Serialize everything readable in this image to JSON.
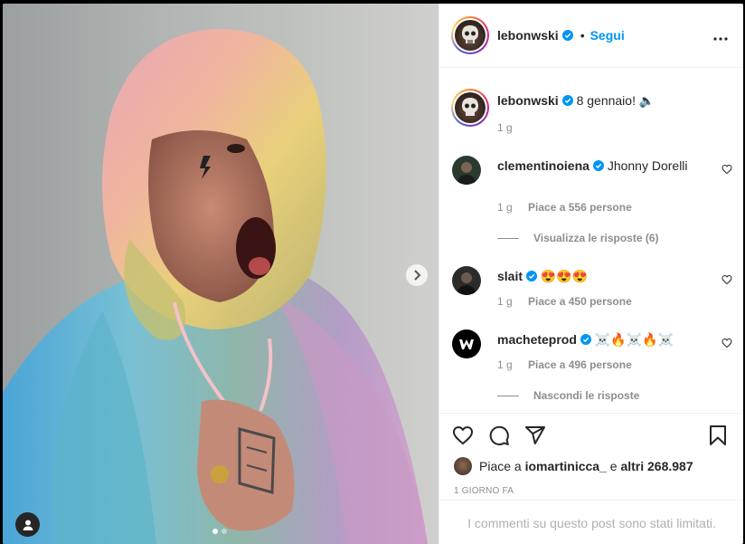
{
  "post": {
    "author": "lebonwski",
    "follow_label": "Segui",
    "caption_user": "lebonwski",
    "caption_text": "8 gennaio! 🔈",
    "caption_time": "1 g"
  },
  "comments": [
    {
      "user": "clementinoiena",
      "text": "Jhonny Dorelli",
      "time": "1 g",
      "likes": "Piace a 556 persone",
      "replies": "Visualizza le risposte (6)"
    },
    {
      "user": "slait",
      "text": "😍😍😍",
      "time": "1 g",
      "likes": "Piace a 450 persone"
    },
    {
      "user": "macheteprod",
      "text": "☠️🔥☠️🔥☠️",
      "time": "1 g",
      "likes": "Piace a 496 persone",
      "replies": "Nascondi le risposte"
    }
  ],
  "footer": {
    "liked_by_prefix": "Piace a",
    "liked_by_user": "iomartinicca_",
    "liked_by_middle": "e",
    "liked_by_others": "altri 268.987",
    "date": "1 GIORNO FA",
    "limited_notice": "I commenti su questo post sono stati limitati."
  },
  "carousel": {
    "count": 2,
    "active": 0
  },
  "colors": {
    "accent": "#0095f6",
    "text": "#262626",
    "muted": "#8e8e8e",
    "border": "#efefef"
  },
  "icons": [
    "verified-icon",
    "more-icon",
    "heart-icon",
    "comment-icon",
    "share-icon",
    "save-icon",
    "chevron-right-icon",
    "user-tag-icon"
  ]
}
